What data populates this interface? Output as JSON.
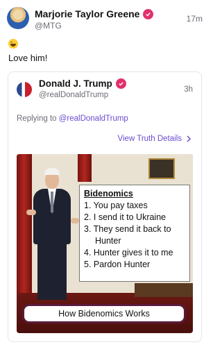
{
  "post": {
    "author_name": "Marjorie Taylor Greene",
    "author_handle": "@MTG",
    "time": "17m",
    "emoji": "laughing-face",
    "text": "Love him!"
  },
  "quoted": {
    "author_name": "Donald J. Trump",
    "author_handle": "@realDonaldTrump",
    "time": "3h",
    "reply_prefix": "Replying to ",
    "reply_handle": "@realDonaldTrump",
    "details_label": "View Truth Details",
    "media": {
      "overlay_title": "Bidenomics",
      "overlay_lines": [
        "1. You pay taxes",
        "2. I send it to Ukraine",
        "3. They send it back to",
        "Hunter",
        "4. Hunter gives it to me",
        "5. Pardon Hunter"
      ],
      "banner_text": "How Bidenomics Works"
    }
  },
  "colors": {
    "verified": "#e1306c",
    "link": "#6a4bd0",
    "muted": "#6b6b75"
  }
}
